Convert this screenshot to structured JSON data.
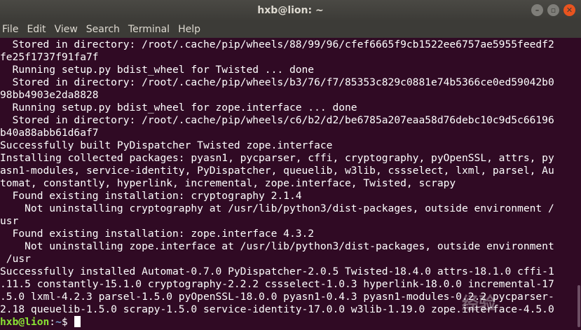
{
  "window": {
    "title": "hxb@lion: ~",
    "controls": {
      "minimize_glyph": "–",
      "maximize_glyph": "▫",
      "close_glyph": "✕"
    }
  },
  "menubar": {
    "items": [
      "File",
      "Edit",
      "View",
      "Search",
      "Terminal",
      "Help"
    ]
  },
  "terminal": {
    "lines": [
      "  Stored in directory: /root/.cache/pip/wheels/88/99/96/cfef6665f9cb1522ee6757ae5955feedf2",
      "fe25f1737f91fa7f",
      "  Running setup.py bdist_wheel for Twisted ... done",
      "  Stored in directory: /root/.cache/pip/wheels/b3/76/f7/85353c829c0881e74b5366ce0ed59042b0",
      "98bb4903e2da8828",
      "  Running setup.py bdist_wheel for zope.interface ... done",
      "  Stored in directory: /root/.cache/pip/wheels/c6/b2/d2/be6785a207eaa58d76debc10c9d5c66196",
      "b40a88abb61d6af7",
      "Successfully built PyDispatcher Twisted zope.interface",
      "Installing collected packages: pyasn1, pycparser, cffi, cryptography, pyOpenSSL, attrs, py",
      "asn1-modules, service-identity, PyDispatcher, queuelib, w3lib, cssselect, lxml, parsel, Au",
      "tomat, constantly, hyperlink, incremental, zope.interface, Twisted, scrapy",
      "  Found existing installation: cryptography 2.1.4",
      "    Not uninstalling cryptography at /usr/lib/python3/dist-packages, outside environment /",
      "usr",
      "  Found existing installation: zope.interface 4.3.2",
      "    Not uninstalling zope.interface at /usr/lib/python3/dist-packages, outside environment",
      " /usr",
      "Successfully installed Automat-0.7.0 PyDispatcher-2.0.5 Twisted-18.4.0 attrs-18.1.0 cffi-1",
      ".11.5 constantly-15.1.0 cryptography-2.2.2 cssselect-1.0.3 hyperlink-18.0.0 incremental-17",
      ".5.0 lxml-4.2.3 parsel-1.5.0 pyOpenSSL-18.0.0 pyasn1-0.4.3 pyasn1-modules-0.2.2 pycparser-",
      "2.18 queuelib-1.5.0 scrapy-1.5.0 service-identity-17.0.0 w3lib-1.19.0 zope.interface-4.5.0"
    ],
    "prompt": {
      "user_host": "hxb@lion",
      "separator": ":",
      "path": "~",
      "symbol": "$ "
    }
  },
  "colors": {
    "background": "#300a24",
    "titlebar": "#3c3b37",
    "prompt_user": "#8ae234",
    "prompt_path": "#729fcf",
    "close_button": "#e9541f"
  },
  "watermark": {
    "text": "经验"
  }
}
